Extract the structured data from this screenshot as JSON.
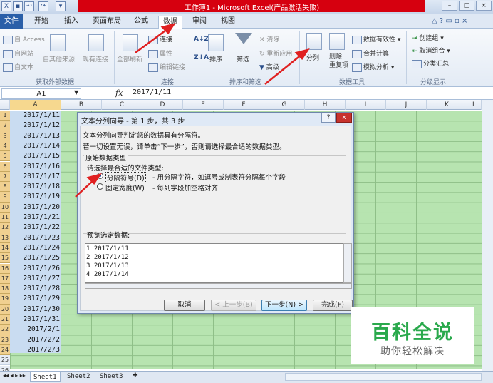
{
  "window": {
    "title": "工作簿1 - Microsoft Excel(产品激活失败)"
  },
  "tabs": [
    {
      "label": "文件"
    },
    {
      "label": "开始"
    },
    {
      "label": "插入"
    },
    {
      "label": "页面布局"
    },
    {
      "label": "公式"
    },
    {
      "label": "数据"
    },
    {
      "label": "审阅"
    },
    {
      "label": "视图"
    }
  ],
  "ribbon": {
    "get_external": {
      "access": "自 Access",
      "web": "自网站",
      "text": "自文本",
      "other": "自其他来源",
      "existing": "现有连接",
      "group": "获取外部数据"
    },
    "connections": {
      "refresh": "全部刷新",
      "connections": "连接",
      "properties": "属性",
      "edit_links": "编辑链接",
      "group": "连接"
    },
    "sort_filter": {
      "sort": "排序",
      "filter": "筛选",
      "clear": "清除",
      "reapply": "重新应用",
      "advanced": "高级",
      "group": "排序和筛选"
    },
    "data_tools": {
      "text_to_columns": "分列",
      "remove_duplicates": "删除\n重复项",
      "data_validation": "数据有效性",
      "consolidate": "合并计算",
      "what_if": "模拟分析",
      "group": "数据工具"
    },
    "outline": {
      "group_btn": "创建组",
      "ungroup": "取消组合",
      "subtotal": "分类汇总",
      "group": "分级显示"
    }
  },
  "formula_bar": {
    "name_box": "A1",
    "fx": "fx",
    "value": "2017/1/11"
  },
  "columns": [
    "A",
    "B",
    "C",
    "D",
    "E",
    "F",
    "G",
    "H",
    "I",
    "J",
    "K",
    "L"
  ],
  "rows": [
    {
      "n": "1",
      "a": "2017/1/11"
    },
    {
      "n": "2",
      "a": "2017/1/12"
    },
    {
      "n": "3",
      "a": "2017/1/13"
    },
    {
      "n": "4",
      "a": "2017/1/14"
    },
    {
      "n": "5",
      "a": "2017/1/15"
    },
    {
      "n": "6",
      "a": "2017/1/16"
    },
    {
      "n": "7",
      "a": "2017/1/17"
    },
    {
      "n": "8",
      "a": "2017/1/18"
    },
    {
      "n": "9",
      "a": "2017/1/19"
    },
    {
      "n": "10",
      "a": "2017/1/20"
    },
    {
      "n": "11",
      "a": "2017/1/21"
    },
    {
      "n": "12",
      "a": "2017/1/22"
    },
    {
      "n": "13",
      "a": "2017/1/23"
    },
    {
      "n": "14",
      "a": "2017/1/24"
    },
    {
      "n": "15",
      "a": "2017/1/25"
    },
    {
      "n": "16",
      "a": "2017/1/26"
    },
    {
      "n": "17",
      "a": "2017/1/27"
    },
    {
      "n": "18",
      "a": "2017/1/28"
    },
    {
      "n": "19",
      "a": "2017/1/29"
    },
    {
      "n": "20",
      "a": "2017/1/30"
    },
    {
      "n": "21",
      "a": "2017/1/31"
    },
    {
      "n": "22",
      "a": "2017/2/1"
    },
    {
      "n": "23",
      "a": "2017/2/2"
    },
    {
      "n": "24",
      "a": "2017/2/3"
    },
    {
      "n": "25",
      "a": ""
    },
    {
      "n": "26",
      "a": ""
    }
  ],
  "sheets": [
    "Sheet1",
    "Sheet2",
    "Sheet3"
  ],
  "dialog": {
    "title": "文本分列向导 - 第 1 步，共 3 步",
    "help": "?",
    "close": "x",
    "line1": "文本分列向导判定您的数据具有分隔符。",
    "line2": "若一切设置无误，请单击“下一步”，否则请选择最合适的数据类型。",
    "section": "原始数据类型",
    "prompt": "请选择最合适的文件类型:",
    "opt1": "分隔符号(D)",
    "opt1_desc": "- 用分隔字符，如逗号或制表符分隔每个字段",
    "opt2": "固定宽度(W)",
    "opt2_desc": "- 每列字段加空格对齐",
    "preview_label": "预览选定数据:",
    "preview": [
      "2017/1/11",
      "2017/1/12",
      "2017/1/13",
      "2017/1/14"
    ],
    "buttons": {
      "cancel": "取消",
      "back": "< 上一步(B)",
      "next": "下一步(N) >",
      "finish": "完成(F)"
    }
  },
  "watermark": {
    "title": "百科全说",
    "subtitle": "助你轻松解决"
  },
  "colors": {
    "title_red": "#d6000f",
    "grid_green": "#b7e4b0",
    "arrow_red": "#e02020",
    "brand_green": "#2aa94c"
  }
}
